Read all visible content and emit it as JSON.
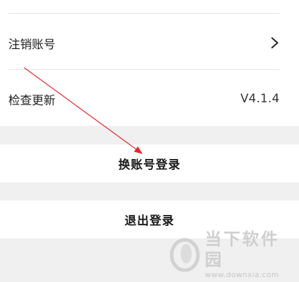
{
  "settings": {
    "items": [
      {
        "label": "注销账号",
        "icon": "chevron-right-icon"
      },
      {
        "label": "检查更新",
        "value": "V4.1.4"
      }
    ]
  },
  "actions": {
    "switch_account": "换账号登录",
    "logout": "退出登录"
  },
  "watermark": {
    "name": "当下软件园",
    "url": "www.downxia.com",
    "icon": "downxia-logo"
  },
  "annotation": {
    "color": "#e8262b"
  }
}
